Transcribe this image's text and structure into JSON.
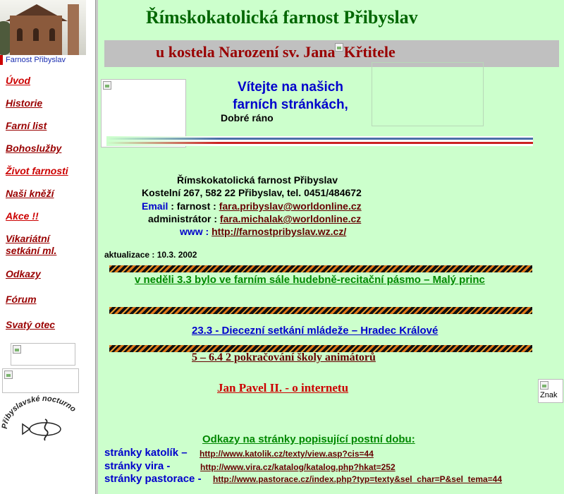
{
  "sidebar": {
    "logo_caption": "Farnost Přibyslav",
    "nav": [
      "Úvod",
      "Historie",
      "Farní list",
      "Bohoslužby",
      "Život farnosti",
      "Naši kněží",
      "Akce !!",
      "Vikariátní setkání ml.",
      "Odkazy",
      "Fórum",
      "Svatý otec"
    ],
    "nocturno_text": "Přibyslavské nocturno"
  },
  "header": {
    "title": "Římskokatolická farnost  Přibyslav",
    "subtitle_part1": "u kostela Narození sv. Jana",
    "subtitle_part2": "Křtitele"
  },
  "welcome": {
    "line1": "Vítejte na našich",
    "line2": "farních stránkách,",
    "greeting": "Dobré ráno"
  },
  "contact": {
    "name": "Římskokatolická farnost Přibyslav",
    "address": "Kostelní 267, 582 22 Přibyslav, tel. 0451/484672",
    "email_label": "Email",
    "email_parish_label": " : farnost : ",
    "email_parish": "fara.pribyslav@worldonline.cz",
    "admin_label": "administrátor : ",
    "email_admin": "fara.michalak@worldonline.cz",
    "www_label": "www : ",
    "www": "http://farnostpribyslav.wz.cz/"
  },
  "update": "aktualizace : 10.3. 2002",
  "announcements": {
    "item1": "v  neděli  3.3 bylo ve farním sále   hudebně-recitační pásmo – Malý princ",
    "item2": "23.3  -  Diecezní setkání mládeže – Hradec Králové",
    "item3": "5 – 6.4     2 pokračování školy animátorů",
    "jp2": "Jan Pavel II. - o  internetu",
    "znak": "Znak"
  },
  "links": {
    "heading": "Odkazy na stránky popisující postní dobu:",
    "rows": [
      {
        "label": "stránky katolík –",
        "url": "http://www.katolik.cz/texty/view.asp?cis=44"
      },
      {
        "label": "stránky  vira  -",
        "url": "http://www.vira.cz/katalog/katalog.php?hkat=252"
      },
      {
        "label": "stránky pastorace -",
        "url": "http://www.pastorace.cz/index.php?typ=texty&sel_char=P&sel_tema=44"
      }
    ]
  }
}
